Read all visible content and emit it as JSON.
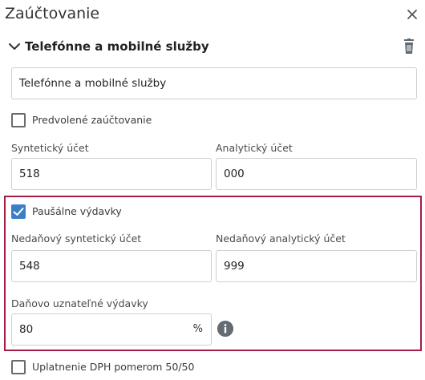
{
  "dialog": {
    "title": "Zaúčtovanie"
  },
  "section": {
    "title": "Telefónne a mobilné služby",
    "name_value": "Telefónne a mobilné služby"
  },
  "default_posting": {
    "label": "Predvolené zaúčtovanie",
    "checked": false
  },
  "synthetic_account": {
    "label": "Syntetický účet",
    "value": "518"
  },
  "analytic_account": {
    "label": "Analytický účet",
    "value": "000"
  },
  "flat_expenses": {
    "label": "Paušálne výdavky",
    "checked": true
  },
  "nontax_synthetic": {
    "label": "Nedaňový syntetický účet",
    "value": "548"
  },
  "nontax_analytic": {
    "label": "Nedaňový analytický účet",
    "value": "999"
  },
  "deductible": {
    "label": "Daňovo uznateľné výdavky",
    "value": "80",
    "unit": "%"
  },
  "vat_ratio": {
    "label": "Uplatnenie DPH pomerom 50/50",
    "checked": false
  },
  "colors": {
    "accent": "#3d7fc7",
    "highlight_border": "#a31d44"
  },
  "icons": {
    "close": "close-icon",
    "chevron": "chevron-down-icon",
    "delete": "trash-icon",
    "info": "info-icon",
    "check": "check-icon"
  }
}
